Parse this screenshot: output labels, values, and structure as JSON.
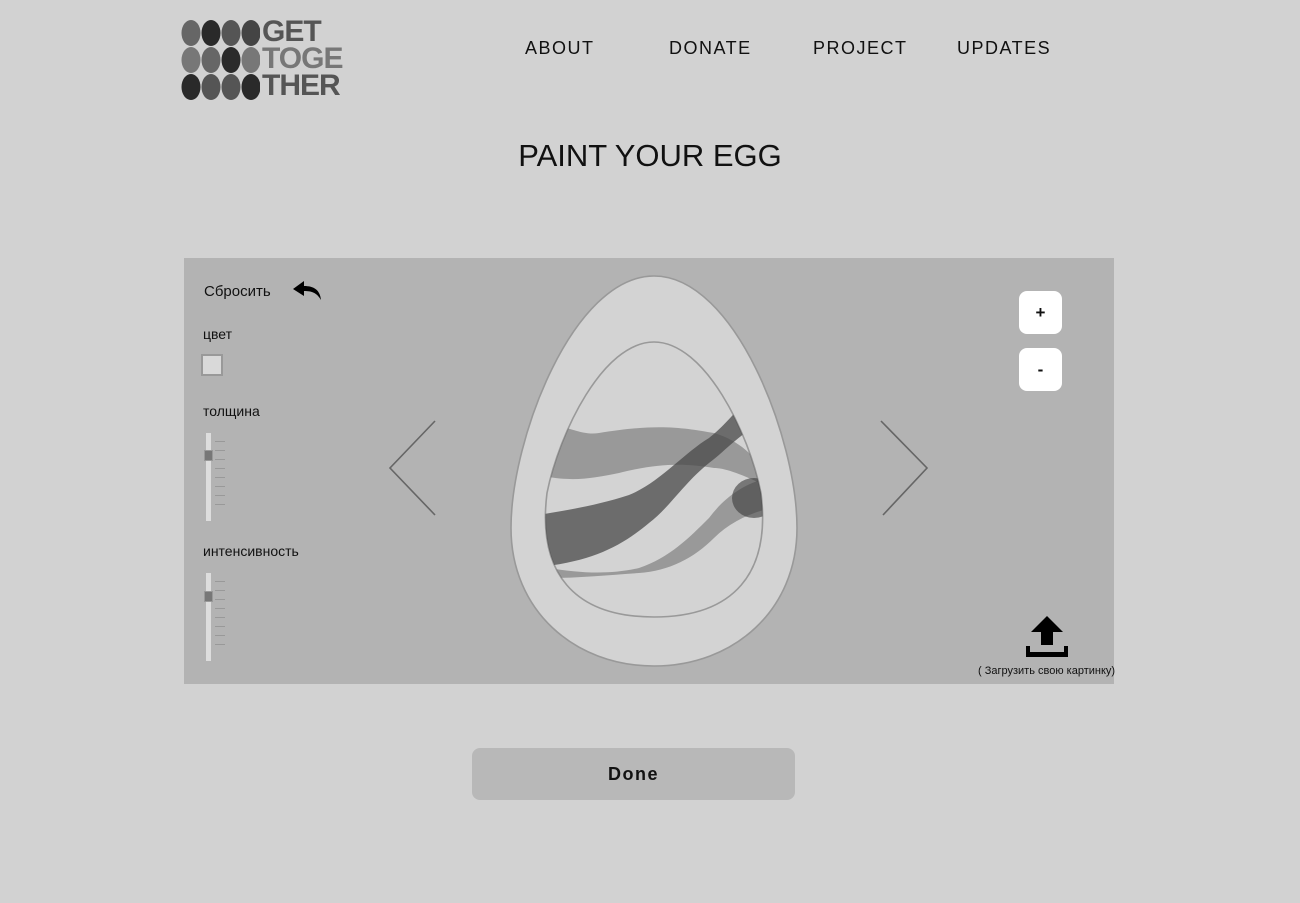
{
  "logo": {
    "line1": "GET",
    "line2": "TOGE",
    "line3": "THER"
  },
  "nav": {
    "about": "ABOUT",
    "donate": "DONATE",
    "project": "PROJECT",
    "updates": "UPDATES"
  },
  "page_title": "PAINT YOUR EGG",
  "editor": {
    "reset_label": "Сбросить",
    "color_label": "цвет",
    "thickness_label": "толщина",
    "intensity_label": "интенсивность",
    "thickness_value": 0.22,
    "intensity_value": 0.24,
    "zoom_in_label": "+",
    "zoom_out_label": "-",
    "upload_label": "( Загрузить свою картинку)"
  },
  "done_label": "Done"
}
